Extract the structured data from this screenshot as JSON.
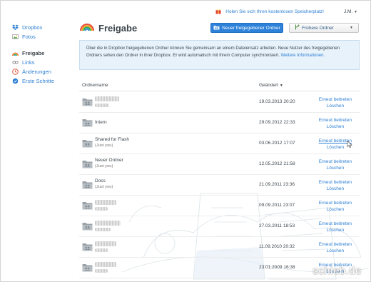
{
  "topbar": {
    "promo_text": "Holen Sie sich Ihren kostenlosen Speicherplatz!",
    "user_label": "J.M.",
    "user_caret": "▼"
  },
  "sidebar": {
    "items": [
      {
        "label": "Dropbox",
        "icon": "dropbox-icon"
      },
      {
        "label": "Fotos",
        "icon": "photos-icon"
      },
      {
        "label": "Freigabe",
        "icon": "rainbow-icon",
        "active": true
      },
      {
        "label": "Links",
        "icon": "link-icon"
      },
      {
        "label": "Änderungen",
        "icon": "clock-icon"
      },
      {
        "label": "Erste Schritte",
        "icon": "steps-icon"
      }
    ]
  },
  "header": {
    "title": "Freigabe",
    "new_folder_button": "Neuer freigegebener Ordner",
    "previous_folders_button": "Frühere Ordner",
    "previous_caret": "▼"
  },
  "info": {
    "text": "Über die in Dropbox freigegebenen Ordner können Sie gemeinsam an einem Dateiensatz arbeiten. Neue Nutzer des freigegebenen Ordners sehen den Ordner in ihrer Dropbox. Er wird automatisch mit ihrem Computer synchronisiert.",
    "more_link": "Weitere Informationen."
  },
  "table": {
    "col_name": "Ordnername",
    "col_date": "Geändert",
    "sort_arrow": "▼",
    "rejoin_label": "Erneut beitreten",
    "delete_label": "Löschen",
    "rows": [
      {
        "name": "",
        "sub": "",
        "date": "19.03.2013 20:20"
      },
      {
        "name": "Intern",
        "sub": "",
        "date": "29.09.2012 22:33"
      },
      {
        "name": "Shared for Flash",
        "sub": "(Just you)",
        "date": "03.06.2012 17:07"
      },
      {
        "name": "Neuer Ordner",
        "sub": "(Just you)",
        "date": "12.05.2012 21:58"
      },
      {
        "name": "Docs",
        "sub": "(Just you)",
        "date": "21.09.2011 23:36"
      },
      {
        "name": "",
        "sub": "",
        "date": "09.09.2011 23:07"
      },
      {
        "name": "",
        "sub": "",
        "date": "27.03.2011 18:53"
      },
      {
        "name": "",
        "sub": "",
        "date": "11.09.2010 20:32"
      },
      {
        "name": "",
        "sub": "",
        "date": "23.01.2009 16:38"
      }
    ]
  },
  "watermark": "schieb.de",
  "colors": {
    "accent": "#2d7fd3",
    "primary_button": "#2d81d9",
    "info_bg": "#e7f2fb",
    "text": "#3d464d"
  }
}
